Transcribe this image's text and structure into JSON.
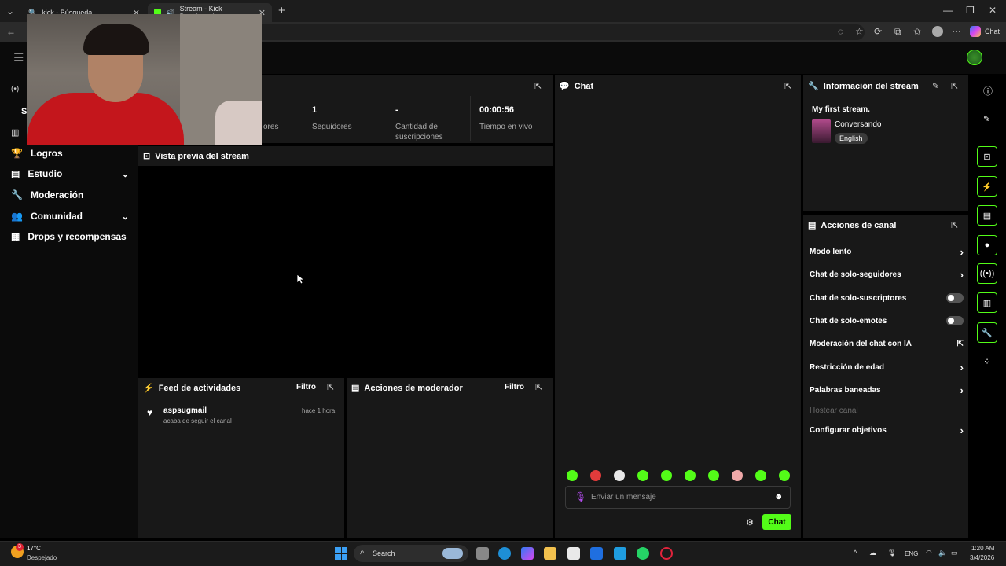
{
  "browser": {
    "tabs": [
      {
        "label": "kick - Búsqueda"
      },
      {
        "label": "Stream - Kick Dashboard"
      }
    ],
    "copilot_label": "Chat"
  },
  "sidebar": {
    "items": [
      {
        "label": "Logros"
      },
      {
        "label": "Estudio"
      },
      {
        "label": "Moderación"
      },
      {
        "label": "Comunidad"
      },
      {
        "label": "Drops y recompensas"
      }
    ]
  },
  "stats": {
    "partial_label": "ores",
    "followers_value": "1",
    "followers_label": "Seguidores",
    "subs_value": "-",
    "subs_label_1": "Cantidad de",
    "subs_label_2": "suscripciones",
    "live_value": "00:00:56",
    "live_label": "Tiempo en vivo"
  },
  "preview": {
    "title": "Vista previa del stream"
  },
  "feed": {
    "title": "Feed de actividades",
    "filter": "Filtro",
    "items": [
      {
        "user": "aspsugmail",
        "time": "hace 1 hora",
        "text": "acaba de seguir el canal"
      }
    ]
  },
  "mod_actions": {
    "title": "Acciones de moderador",
    "filter": "Filtro"
  },
  "chat": {
    "title": "Chat",
    "placeholder": "Enviar un mensaje",
    "send_label": "Chat"
  },
  "stream_info": {
    "title": "Información del stream",
    "stream_title": "My first stream.",
    "category": "Conversando",
    "language": "English"
  },
  "channel_actions": {
    "title": "Acciones de canal",
    "slow_mode": "Modo lento",
    "followers_only": "Chat de solo-seguidores",
    "subs_only": "Chat de solo-suscriptores",
    "emotes_only": "Chat de solo-emotes",
    "ai_moderation": "Moderación del chat con IA",
    "age_restriction": "Restricción de edad",
    "banned_words": "Palabras baneadas",
    "host_channel": "Hostear canal",
    "goals": "Configurar objetivos"
  },
  "taskbar": {
    "weather_temp": "17°C",
    "weather_desc": "Despejado",
    "weather_badge": "3",
    "search": "Search",
    "lang": "ENG",
    "time": "1:20 AM",
    "date": "3/4/2026"
  },
  "colors": {
    "accent": "#53fc18",
    "panel": "#181818",
    "background": "#000000"
  }
}
